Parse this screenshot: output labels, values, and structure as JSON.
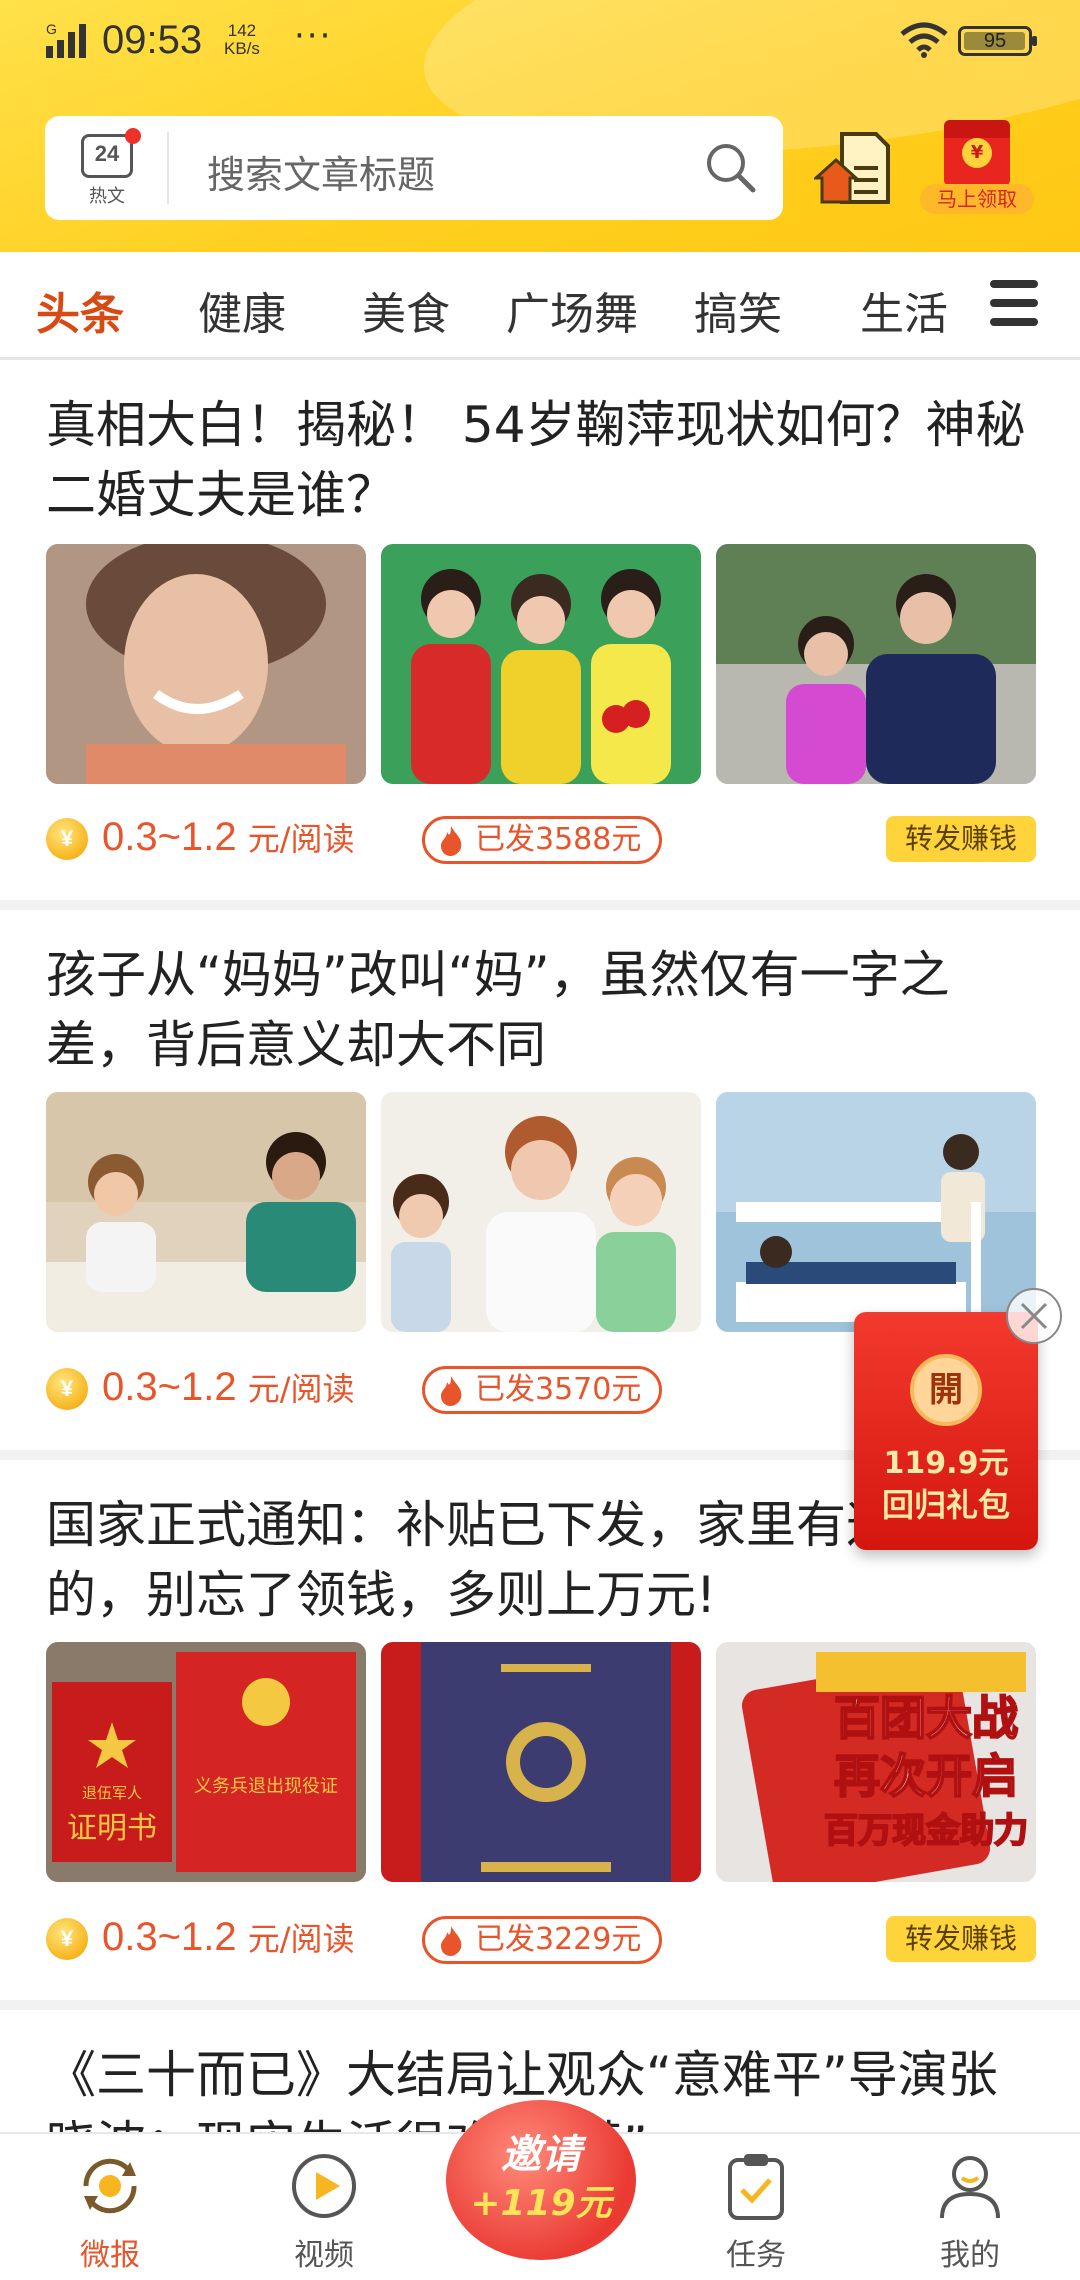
{
  "status_bar": {
    "time": "09:53",
    "speed_value": "142",
    "speed_unit": "KB/s",
    "more": "···",
    "battery": "95"
  },
  "header": {
    "hot_icon_number": "24",
    "hot_icon_label": "热文",
    "search_placeholder": "搜索文章标题",
    "redpack_label": "马上领取",
    "redpack_symbol": "¥"
  },
  "tabs": [
    "头条",
    "健康",
    "美食",
    "广场舞",
    "搞笑",
    "生活"
  ],
  "articles": [
    {
      "title": "真相大白！揭秘！ 54岁鞠萍现状如何？神秘二婚丈夫是谁？",
      "price": "0.3~1.2",
      "unit": "元/阅读",
      "sent": "已发3588元",
      "share": "转发赚钱",
      "thumbs": [
        "#b9a08c",
        "#3fa35a",
        "#6f8f6a"
      ]
    },
    {
      "title": "孩子从“妈妈”改叫“妈”，虽然仅有一字之差，背后意义却大不同",
      "price": "0.3~1.2",
      "unit": "元/阅读",
      "sent": "已发3570元",
      "thumbs": [
        "#d8c8b0",
        "#e8e0d6",
        "#a9c6d8"
      ]
    },
    {
      "title": "国家正式通知：补贴已下发，家里有这个证的，别忘了领钱，多则上万元!",
      "price": "0.3~1.2",
      "unit": "元/阅读",
      "sent": "已发3229元",
      "share": "转发赚钱",
      "thumbs": [
        "#c81c1c",
        "#3a3a66",
        "#cf3326"
      ],
      "thumb_texts": {
        "book1_line1": "退伍军人",
        "book1_line2": "证明书",
        "book2_line1": "义务兵退出现役证",
        "promo_line1": "百团大战",
        "promo_line2": "再次开启",
        "promo_line3": "百万现金助力"
      }
    },
    {
      "title": "《三十而已》大结局让观众“意难平”导演张晓波：现实生活很难“圆满”"
    }
  ],
  "coin_symbol": "¥",
  "float_pack": {
    "seal": "開",
    "amount": "119.9元",
    "label": "回归礼包"
  },
  "bottom_nav": [
    "微报",
    "视频",
    "任务",
    "我的"
  ],
  "invite": {
    "line1": "邀请",
    "line2": "+119元"
  },
  "colors": {
    "brand_yellow": "#ffcf1f",
    "accent_orange": "#e8552a",
    "active_tab": "#d84a14",
    "share_button": "#ffd43a"
  }
}
